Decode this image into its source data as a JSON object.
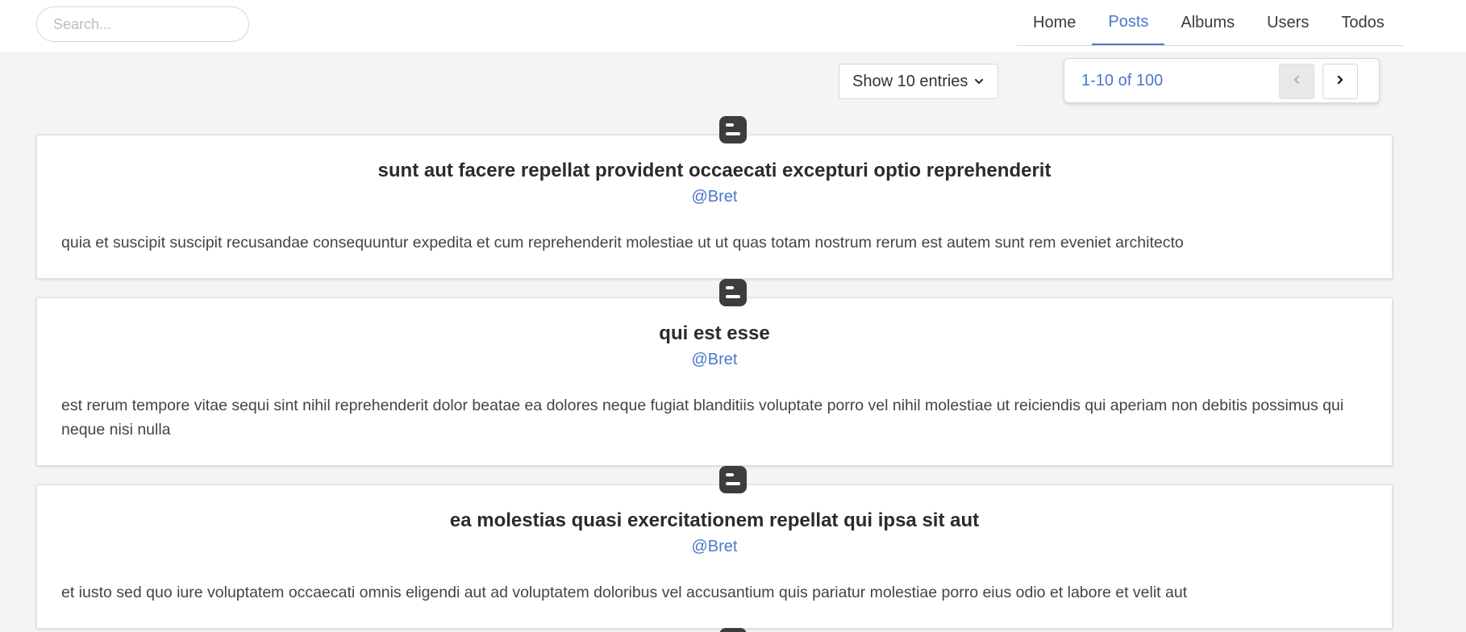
{
  "search": {
    "placeholder": "Search..."
  },
  "nav": {
    "items": [
      {
        "label": "Home",
        "active": false
      },
      {
        "label": "Posts",
        "active": true
      },
      {
        "label": "Albums",
        "active": false
      },
      {
        "label": "Users",
        "active": false
      },
      {
        "label": "Todos",
        "active": false
      }
    ]
  },
  "entries": {
    "label": "Show 10 entries",
    "icon": "chevron-down-icon"
  },
  "pagination": {
    "range": "1-10 of 100",
    "prev_icon": "chevron-left-icon",
    "next_icon": "chevron-right-icon"
  },
  "colors": {
    "accent": "#4a78c8",
    "icon": "#3d3d3d",
    "background": "#f4f4f4"
  },
  "posts": [
    {
      "icon": "blogger-icon",
      "title": "sunt aut facere repellat provident occaecati excepturi optio reprehenderit",
      "user": "@Bret",
      "body": "quia et suscipit suscipit recusandae consequuntur expedita et cum reprehenderit molestiae ut ut quas totam nostrum rerum est autem sunt rem eveniet architecto"
    },
    {
      "icon": "blogger-icon",
      "title": "qui est esse",
      "user": "@Bret",
      "body": "est rerum tempore vitae sequi sint nihil reprehenderit dolor beatae ea dolores neque fugiat blanditiis voluptate porro vel nihil molestiae ut reiciendis qui aperiam non debitis possimus qui neque nisi nulla"
    },
    {
      "icon": "blogger-icon",
      "title": "ea molestias quasi exercitationem repellat qui ipsa sit aut",
      "user": "@Bret",
      "body": "et iusto sed quo iure voluptatem occaecati omnis eligendi aut ad voluptatem doloribus vel accusantium quis pariatur molestiae porro eius odio et labore et velit aut"
    }
  ]
}
